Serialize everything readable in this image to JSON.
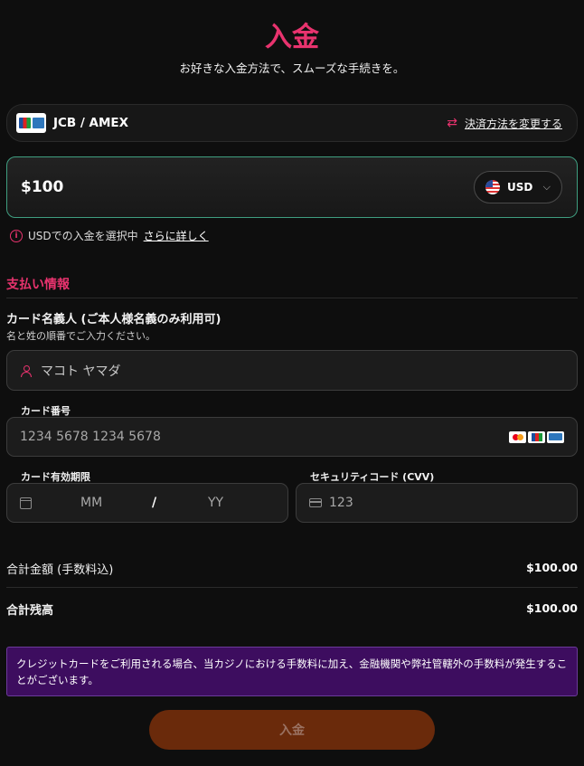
{
  "header": {
    "title": "入金",
    "subtitle": "お好きな入金方法で、スムーズな手続きを。"
  },
  "payment_method": {
    "name": "JCB / AMEX",
    "change_label": "決済方法を変更する",
    "icon": "arrows-exchange-icon"
  },
  "amount": {
    "value": "$100",
    "currency": "USD"
  },
  "currency_info": {
    "text": "USDでの入金を選択中",
    "link": "さらに詳しく"
  },
  "payment_info": {
    "section_title": "支払い情報",
    "cardholder": {
      "label": "カード名義人 (ご本人様名義のみ利用可)",
      "hint": "名と姓の順番でご入力ください。",
      "placeholder": "マコト ヤマダ"
    },
    "card_number": {
      "label": "カード番号",
      "placeholder": "1234 5678 1234 5678"
    },
    "expiry": {
      "label": "カード有効期限",
      "month_placeholder": "MM",
      "separator": "/",
      "year_placeholder": "YY"
    },
    "cvv": {
      "label": "セキュリティコード (CVV)",
      "placeholder": "123"
    }
  },
  "summary": {
    "total_fee_label": "合計金額 (手数料込)",
    "total_fee_value": "$100.00",
    "total_balance_label": "合計残高",
    "total_balance_value": "$100.00"
  },
  "notice": "クレジットカードをご利用される場合、当カジノにおける手数料に加え、金融機関や弊社管轄外の手数料が発生することがございます。",
  "submit_label": "入金",
  "colors": {
    "accent": "#e8336e",
    "background": "#0e0e0e",
    "amount_border": "#3f9e80",
    "notice_bg": "#3d0d5f",
    "submit_bg": "#6a2a0b"
  }
}
